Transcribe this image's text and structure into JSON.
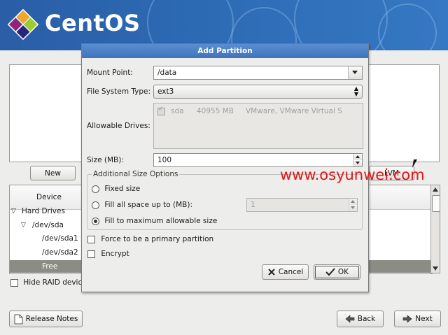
{
  "brand": {
    "name": "CentOS"
  },
  "background": {
    "new_button": "New",
    "lvm_button": "LVM",
    "table_header": "Device",
    "tree": [
      {
        "label": "Hard Drives",
        "level": 0,
        "expander": true
      },
      {
        "label": "/dev/sda",
        "level": 1,
        "expander": true
      },
      {
        "label": "/dev/sda1",
        "level": 2,
        "expander": false
      },
      {
        "label": "/dev/sda2",
        "level": 2,
        "expander": false
      },
      {
        "label": "Free",
        "level": 2,
        "expander": false,
        "selected": true
      }
    ],
    "hide_raid_label": "Hide RAID device"
  },
  "dialog": {
    "title": "Add Partition",
    "mount_point_label": "Mount Point:",
    "mount_point_value": "/data",
    "fs_type_label": "File System Type:",
    "fs_type_value": "ext3",
    "allowable_drives_label": "Allowable Drives:",
    "drive": {
      "name": "sda",
      "size": "40955 MB",
      "model": "VMware, VMware Virtual S"
    },
    "size_label": "Size (MB):",
    "size_value": "100",
    "additional_size_title": "Additional Size Options",
    "fixed_size_label": "Fixed size",
    "fill_upto_label": "Fill all space up to (MB):",
    "fill_upto_value": "1",
    "fill_max_label": "Fill to maximum allowable size",
    "primary_label": "Force to be a primary partition",
    "encrypt_label": "Encrypt",
    "cancel_label": "Cancel",
    "ok_label": "OK"
  },
  "footer": {
    "release_notes": "Release Notes",
    "back": "Back",
    "next": "Next"
  },
  "watermark": "www.osyunwei.com",
  "colors": {
    "banner": "#2c69b3",
    "title_bar": "#4a80c6",
    "watermark": "#e01616",
    "selected_row": "#8c8c87"
  }
}
